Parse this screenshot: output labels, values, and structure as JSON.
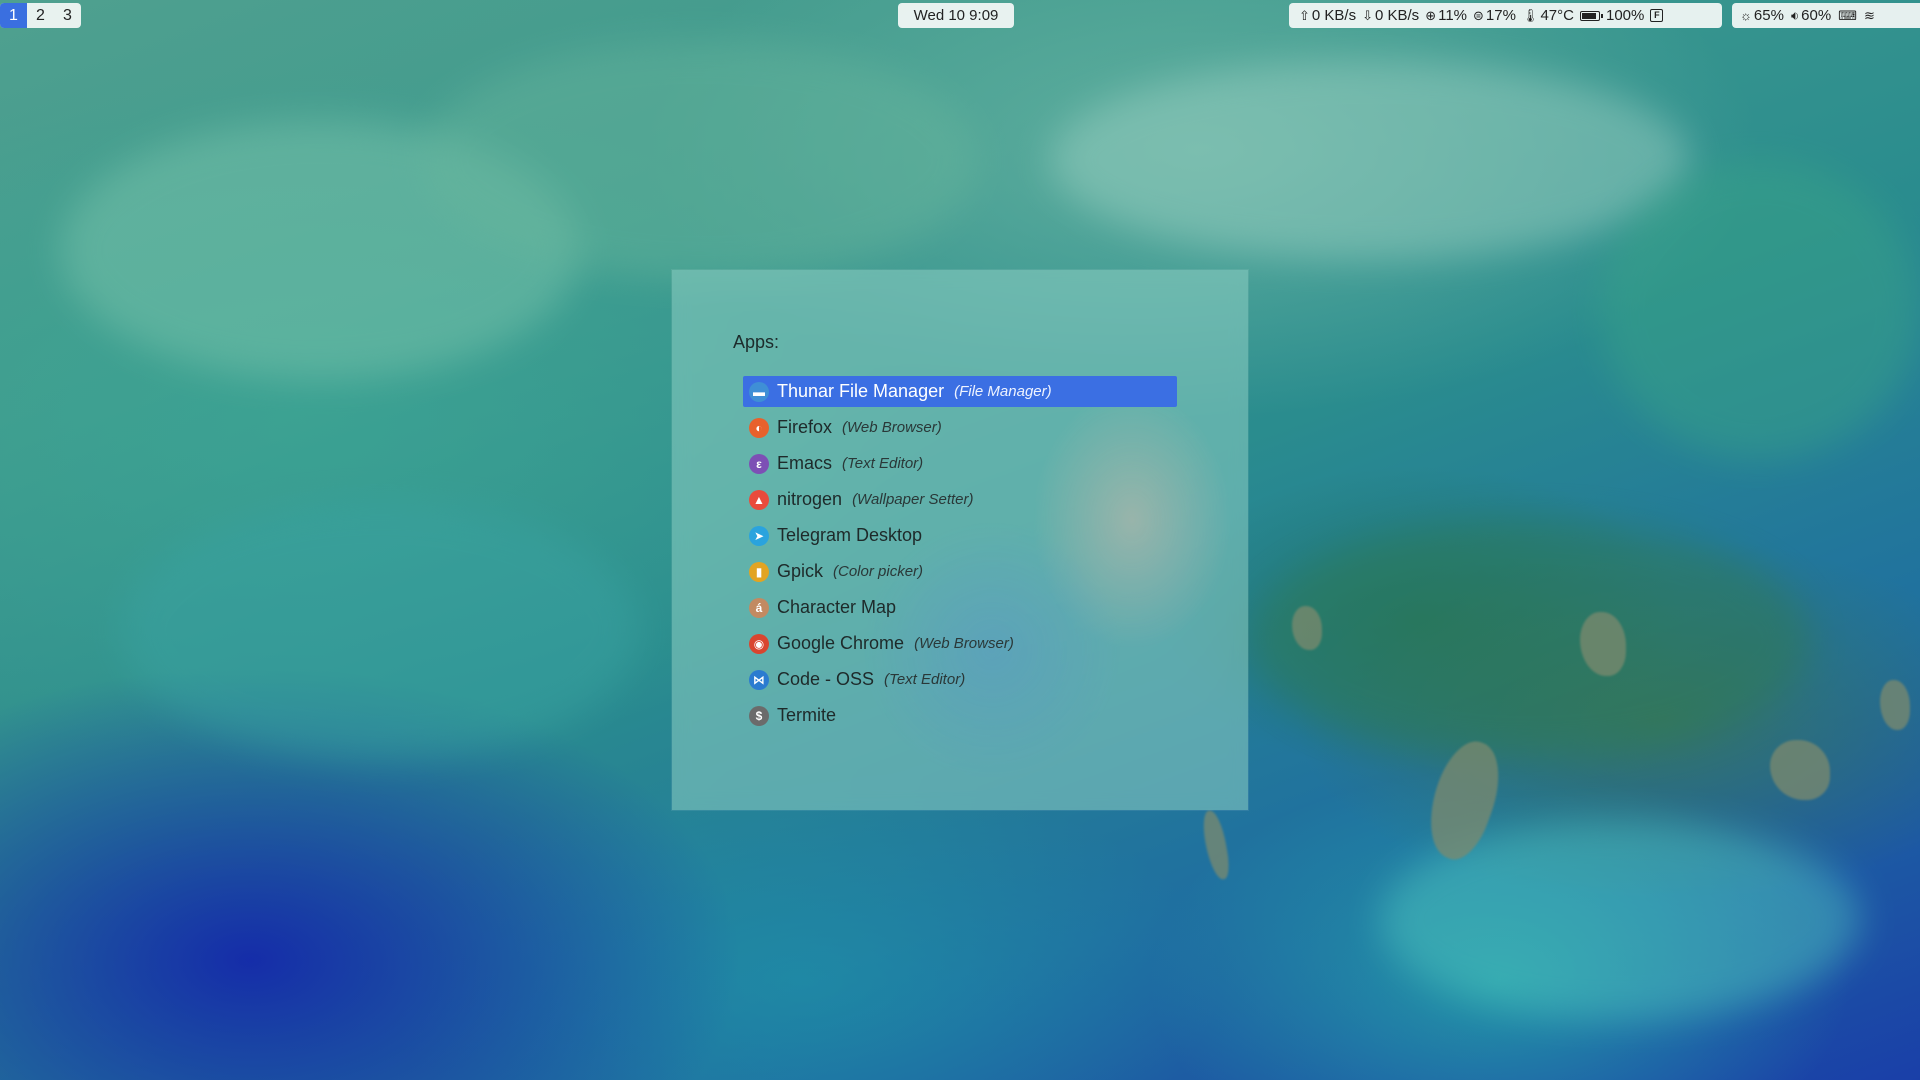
{
  "workspaces": [
    {
      "label": "1",
      "active": true
    },
    {
      "label": "2",
      "active": false
    },
    {
      "label": "3",
      "active": false
    }
  ],
  "clock": "Wed 10  9:09",
  "sysinfo": {
    "upload": "0 KB/s",
    "download": "0 KB/s",
    "cpu": "11%",
    "memory": "17%",
    "temperature": "47°C",
    "battery": "100%",
    "battery_level": 1.0,
    "layout_indicator": "F"
  },
  "controls": {
    "brightness": "65%",
    "volume": "60%"
  },
  "launcher": {
    "prompt": "Apps:",
    "items": [
      {
        "name": "Thunar File Manager",
        "desc": "(File Manager)",
        "icon": "folder-icon",
        "color": "#3f8fd6",
        "glyph": "▬",
        "selected": true
      },
      {
        "name": "Firefox",
        "desc": "(Web Browser)",
        "icon": "firefox-icon",
        "color": "#e8612c",
        "glyph": "◐",
        "selected": false
      },
      {
        "name": "Emacs",
        "desc": "(Text Editor)",
        "icon": "emacs-icon",
        "color": "#7d4fb5",
        "glyph": "ε",
        "selected": false
      },
      {
        "name": "nitrogen",
        "desc": "(Wallpaper Setter)",
        "icon": "nitrogen-icon",
        "color": "#e94b3c",
        "glyph": "▲",
        "selected": false
      },
      {
        "name": "Telegram Desktop",
        "desc": "",
        "icon": "telegram-icon",
        "color": "#2aa3de",
        "glyph": "➤",
        "selected": false
      },
      {
        "name": "Gpick",
        "desc": "(Color picker)",
        "icon": "gpick-icon",
        "color": "#e2a422",
        "glyph": "▮",
        "selected": false
      },
      {
        "name": "Character Map",
        "desc": "",
        "icon": "character-map-icon",
        "color": "#c28a62",
        "glyph": "á",
        "selected": false
      },
      {
        "name": "Google Chrome",
        "desc": "(Web Browser)",
        "icon": "chrome-icon",
        "color": "#d9452f",
        "glyph": "◉",
        "selected": false
      },
      {
        "name": "Code - OSS",
        "desc": "(Text Editor)",
        "icon": "code-oss-icon",
        "color": "#2b7bd0",
        "glyph": "⋈",
        "selected": false
      },
      {
        "name": "Termite",
        "desc": "",
        "icon": "terminal-icon",
        "color": "#6b6b6b",
        "glyph": "$",
        "selected": false
      }
    ]
  }
}
